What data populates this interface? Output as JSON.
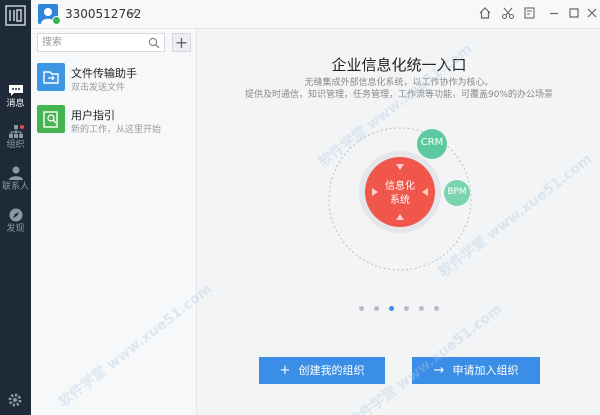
{
  "nav": {
    "items": [
      {
        "label": "消息",
        "icon": "chat-icon",
        "active": true
      },
      {
        "label": "组织",
        "icon": "org-icon",
        "badge": true
      },
      {
        "label": "联系人",
        "icon": "contact-icon"
      },
      {
        "label": "发现",
        "icon": "discover-icon"
      }
    ]
  },
  "topbar": {
    "account": "3300512762"
  },
  "search": {
    "placeholder": "搜索",
    "value": ""
  },
  "conversations": [
    {
      "title": "文件传输助手",
      "subtitle": "双击发送文件",
      "icon": "file-transfer-icon",
      "color": "#3c96e4"
    },
    {
      "title": "用户指引",
      "subtitle": "新的工作，从这里开始",
      "icon": "guide-icon",
      "color": "#45b34f"
    }
  ],
  "main": {
    "headline": "企业信息化统一入口",
    "line1": "无缝集成外部信息化系统，以工作协作为核心。",
    "line2": "提供及时通信，知识管理，任务管理，工作流等功能，可覆盖90%的办公场景",
    "center_line1": "信息化",
    "center_line2": "系统",
    "crm": "CRM",
    "bpm": "BPM",
    "page_dots": 6,
    "active_dot": 3,
    "create_org": "创建我的组织",
    "join_org": "申请加入组织"
  },
  "watermark": "软件学堂 www.xue51.com",
  "colors": {
    "nav_bg": "#1f2a38",
    "accent": "#3a8ee6",
    "center_red": "#f0564a",
    "satellite_green": "#5cc9a0"
  }
}
